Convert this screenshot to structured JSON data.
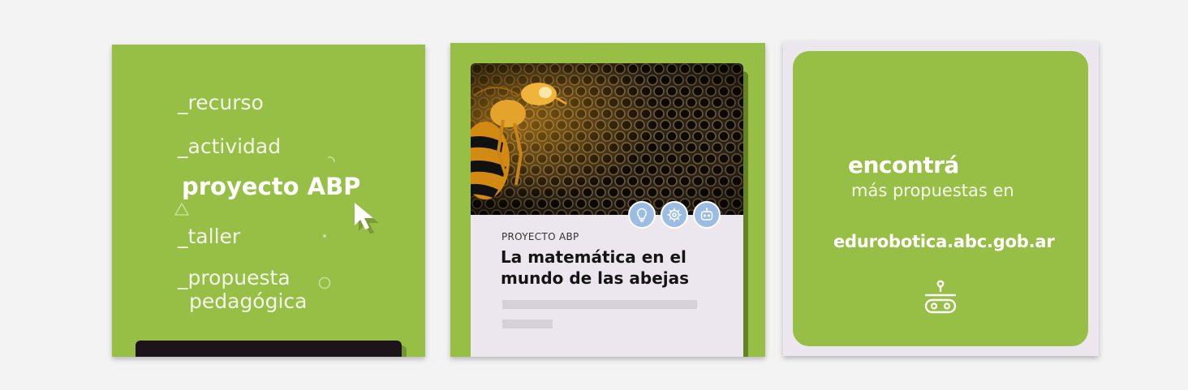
{
  "panel1": {
    "menu": [
      "_recurso",
      "_actividad",
      "proyecto ABP",
      "_taller"
    ],
    "last_item_line1": "_propuesta",
    "last_item_line2": "pedagógica",
    "cursor_icon": "arrow-cursor-icon"
  },
  "panel2": {
    "category": "PROYECTO ABP",
    "title": "La matemática en el mundo de las abejas",
    "badges": [
      "lightbulb-icon",
      "gear-icon",
      "robot-icon"
    ],
    "image": "robot-bee-on-honeycomb"
  },
  "panel3": {
    "line1": "encontrá",
    "line2": "más propuestas en",
    "url": "edurobotica.abc.gob.ar",
    "icon": "robot-icon"
  },
  "colors": {
    "green": "#97bf45",
    "card": "#ece7ef",
    "badge": "#9bbde3",
    "dark": "#1c1418"
  }
}
